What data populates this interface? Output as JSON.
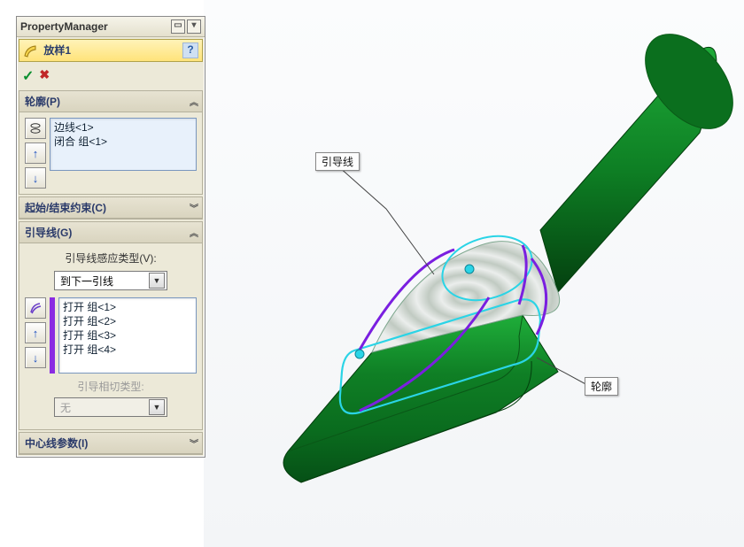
{
  "panel": {
    "title": "PropertyManager",
    "feature_name": "放样1",
    "ok_glyph": "✓",
    "cancel_glyph": "✖",
    "help_glyph": "?"
  },
  "groups": {
    "profiles": {
      "header": "轮廓(P)",
      "items": [
        "边线<1>",
        "闭合 组<1>"
      ],
      "expanded": true
    },
    "start_end": {
      "header": "起始/结束约束(C)",
      "expanded": false
    },
    "guide": {
      "header": "引导线(G)",
      "influence_label": "引导线感应类型(V):",
      "influence_value": "到下一引线",
      "items": [
        "打开 组<1>",
        "打开 组<2>",
        "打开 组<3>",
        "打开 组<4>"
      ],
      "tangent_label": "引导相切类型:",
      "tangent_value": "无",
      "expanded": true
    },
    "centerline": {
      "header": "中心线参数(I)",
      "expanded": false
    }
  },
  "callouts": {
    "guide_line": "引导线",
    "profile": "轮廓"
  },
  "icons": {
    "up": "↑",
    "down": "↓",
    "chev_up": "︽",
    "chev_down": "︾"
  }
}
